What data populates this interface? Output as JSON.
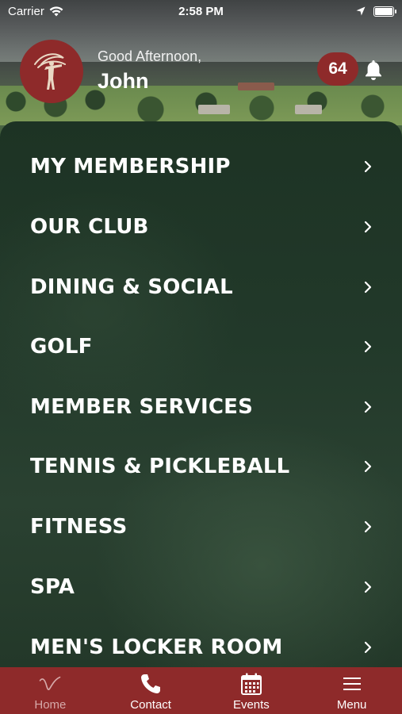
{
  "status_bar": {
    "carrier": "Carrier",
    "time": "2:58 PM"
  },
  "header": {
    "greeting": "Good Afternoon,",
    "user_name": "John",
    "notification_count": "64",
    "logo_icon": "club-logo-figure-icon",
    "bell_icon": "bell-icon"
  },
  "menu": {
    "items": [
      {
        "label": "MY MEMBERSHIP"
      },
      {
        "label": "OUR CLUB"
      },
      {
        "label": "DINING & SOCIAL"
      },
      {
        "label": "GOLF"
      },
      {
        "label": "MEMBER SERVICES"
      },
      {
        "label": "TENNIS & PICKLEBALL"
      },
      {
        "label": "FITNESS"
      },
      {
        "label": "SPA"
      },
      {
        "label": "MEN'S LOCKER ROOM"
      }
    ],
    "chevron_icon": "chevron-right-icon"
  },
  "tabbar": {
    "tabs": [
      {
        "label": "Home",
        "icon": "club-swoosh-icon",
        "active": true
      },
      {
        "label": "Contact",
        "icon": "phone-icon",
        "active": false
      },
      {
        "label": "Events",
        "icon": "calendar-icon",
        "active": false
      },
      {
        "label": "Menu",
        "icon": "hamburger-icon",
        "active": false
      }
    ]
  },
  "colors": {
    "brand": "#8e2a2a",
    "panel": "#22392a",
    "text": "#ffffff",
    "active_tab_text": "#d6a9a9"
  }
}
